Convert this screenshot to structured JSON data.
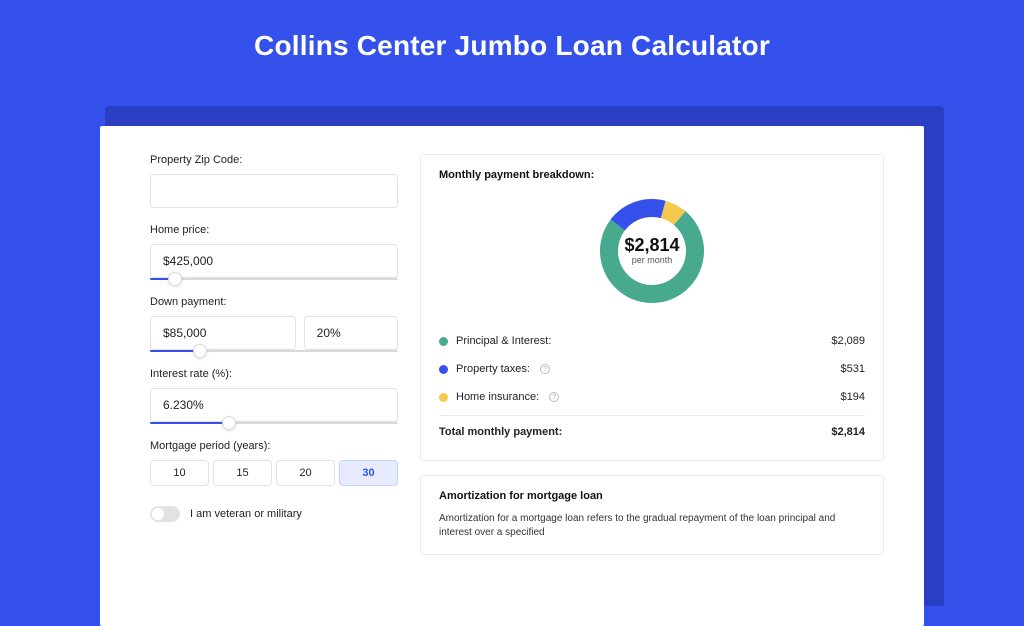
{
  "title": "Collins Center Jumbo Loan Calculator",
  "colors": {
    "principal": "#47a98e",
    "taxes": "#3452eb",
    "insurance": "#f3ca4f"
  },
  "form": {
    "zip_label": "Property Zip Code:",
    "zip_value": "",
    "home_price_label": "Home price:",
    "home_price_value": "$425,000",
    "home_price_slider_pct": 10,
    "down_label": "Down payment:",
    "down_amount_value": "$85,000",
    "down_pct_value": "20%",
    "down_slider_pct": 20,
    "rate_label": "Interest rate (%):",
    "rate_value": "6.230%",
    "rate_slider_pct": 32,
    "period_label": "Mortgage period (years):",
    "periods": [
      "10",
      "15",
      "20",
      "30"
    ],
    "period_active_index": 3,
    "veteran_label": "I am veteran or military"
  },
  "breakdown": {
    "title": "Monthly payment breakdown:",
    "center_amount": "$2,814",
    "center_label": "per month",
    "items": [
      {
        "label": "Principal & Interest:",
        "value": "$2,089"
      },
      {
        "label": "Property taxes:",
        "value": "$531"
      },
      {
        "label": "Home insurance:",
        "value": "$194"
      }
    ],
    "total_label": "Total monthly payment:",
    "total_value": "$2,814"
  },
  "amort": {
    "title": "Amortization for mortgage loan",
    "body": "Amortization for a mortgage loan refers to the gradual repayment of the loan principal and interest over a specified"
  },
  "chart_data": {
    "type": "pie",
    "title": "Monthly payment breakdown",
    "series": [
      {
        "name": "Principal & Interest",
        "value": 2089
      },
      {
        "name": "Property taxes",
        "value": 531
      },
      {
        "name": "Home insurance",
        "value": 194
      }
    ],
    "total": 2814
  }
}
